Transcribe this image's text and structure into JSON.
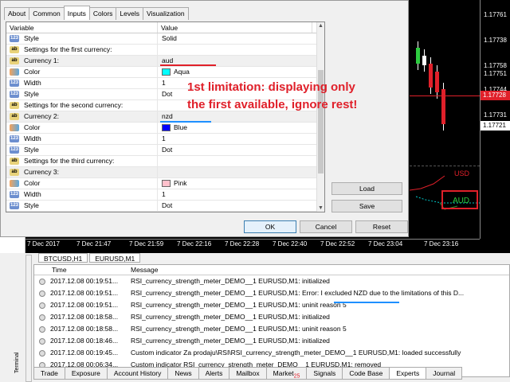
{
  "dialog": {
    "tabs": [
      "About",
      "Common",
      "Inputs",
      "Colors",
      "Levels",
      "Visualization"
    ],
    "active_tab": 2,
    "grid_headers": [
      "Variable",
      "Value"
    ],
    "rows": [
      {
        "icon": "int",
        "var": "Style",
        "val": "Solid"
      },
      {
        "icon": "ab",
        "var": "Settings for the first currency:",
        "val": ""
      },
      {
        "icon": "ab",
        "var": "Currency 1:",
        "val": "aud",
        "hl": true
      },
      {
        "icon": "color",
        "var": "Color",
        "val": "Aqua",
        "swatch": "#00ffff"
      },
      {
        "icon": "int",
        "var": "Width",
        "val": "1"
      },
      {
        "icon": "int",
        "var": "Style",
        "val": "Dot"
      },
      {
        "icon": "ab",
        "var": "Settings for the second currency:",
        "val": ""
      },
      {
        "icon": "ab",
        "var": "Currency 2:",
        "val": "nzd",
        "hl": true
      },
      {
        "icon": "color",
        "var": "Color",
        "val": "Blue",
        "swatch": "#0000ff"
      },
      {
        "icon": "int",
        "var": "Width",
        "val": "1"
      },
      {
        "icon": "int",
        "var": "Style",
        "val": "Dot"
      },
      {
        "icon": "ab",
        "var": "Settings for the third currency:",
        "val": ""
      },
      {
        "icon": "ab",
        "var": "Currency 3:",
        "val": "",
        "hl": true
      },
      {
        "icon": "color",
        "var": "Color",
        "val": "Pink",
        "swatch": "#ffc0cb"
      },
      {
        "icon": "int",
        "var": "Width",
        "val": "1"
      },
      {
        "icon": "int",
        "var": "Style",
        "val": "Dot"
      }
    ],
    "buttons": {
      "load": "Load",
      "save": "Save",
      "ok": "OK",
      "cancel": "Cancel",
      "reset": "Reset"
    },
    "annotation_line1": "1st limitation: displaying only",
    "annotation_line2": "the first available, ignore rest!"
  },
  "chart": {
    "prices": [
      "1.17761",
      "1.17738",
      "1.17758",
      "1.17751",
      "1.17744",
      "1.17738",
      "1.17731",
      "1.17728",
      "1.17721"
    ],
    "highlight_price": "1.17728",
    "box_price": "1.17721",
    "time_labels": [
      "7 Dec 2017",
      "7 Dec 21:47",
      "7 Dec 21:59",
      "7 Dec 22:16",
      "7 Dec 22:28",
      "7 Dec 22:40",
      "7 Dec 22:52",
      "7 Dec 23:04",
      "7 Dec 23:16"
    ],
    "usd_label": "USD",
    "aud_label": "AUD"
  },
  "terminal": {
    "symbol_tabs": [
      "BTCUSD,H1",
      "EURUSD,M1"
    ],
    "side_label": "Terminal",
    "log_headers": [
      "Time",
      "Message"
    ],
    "log_rows": [
      {
        "time": "2017.12.08 00:19:51...",
        "msg": "RSI_currency_strength_meter_DEMO__1 EURUSD,M1: initialized"
      },
      {
        "time": "2017.12.08 00:19:51...",
        "msg": "RSI_currency_strength_meter_DEMO__1 EURUSD,M1: Error: I excluded NZD due to the limitations of this D..."
      },
      {
        "time": "2017.12.08 00:19:51...",
        "msg": "RSI_currency_strength_meter_DEMO__1 EURUSD,M1: uninit reason 5"
      },
      {
        "time": "2017.12.08 00:18:58...",
        "msg": "RSI_currency_strength_meter_DEMO__1 EURUSD,M1: initialized"
      },
      {
        "time": "2017.12.08 00:18:58...",
        "msg": "RSI_currency_strength_meter_DEMO__1 EURUSD,M1: uninit reason 5"
      },
      {
        "time": "2017.12.08 00:18:46...",
        "msg": "RSI_currency_strength_meter_DEMO__1 EURUSD,M1: initialized"
      },
      {
        "time": "2017.12.08 00:19:45...",
        "msg": "Custom indicator Za prodaju\\RSI\\RSI_currency_strength_meter_DEMO__1 EURUSD,M1: loaded successfully"
      },
      {
        "time": "2017.12.08 00:06:34...",
        "msg": "Custom indicator RSI_currency_strength_meter_DEMO__1 EURUSD,M1: removed"
      },
      {
        "time": "2017.12.08 00:06:34...",
        "msg": "RSI_currency_strength_meter_DEMO__1 EURUSD,M1: ..."
      }
    ],
    "bottom_tabs": [
      "Trade",
      "Exposure",
      "Account History",
      "News",
      "Alerts",
      "Mailbox",
      "Market",
      "Signals",
      "Code Base",
      "Experts",
      "Journal"
    ],
    "market_badge": "25",
    "active_bottom_tab": 9
  }
}
